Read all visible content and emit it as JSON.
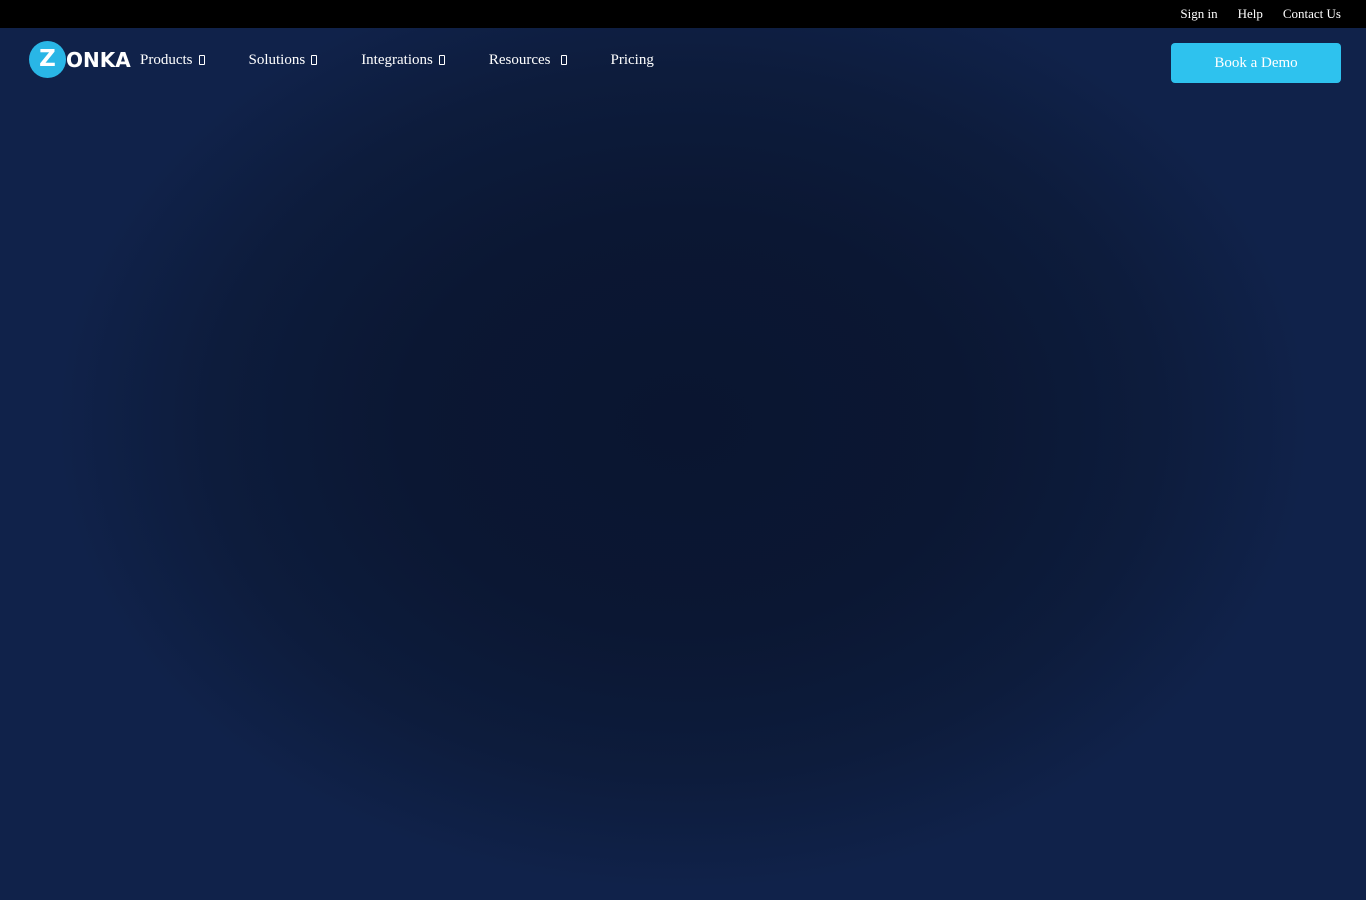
{
  "topbar": {
    "links": [
      {
        "label": "Sign in"
      },
      {
        "label": "Help"
      },
      {
        "label": "Contact Us"
      }
    ]
  },
  "logo": {
    "badge_letter": "Z",
    "wordmark": "ONKA"
  },
  "nav": {
    "items": [
      {
        "label": "Products",
        "has_dropdown": true
      },
      {
        "label": "Solutions",
        "has_dropdown": true
      },
      {
        "label": "Integrations",
        "has_dropdown": true
      },
      {
        "label": "Resources",
        "has_dropdown": true
      },
      {
        "label": "Pricing",
        "has_dropdown": false
      }
    ],
    "cta_label": "Book a Demo"
  },
  "colors": {
    "topbar_bg": "#000000",
    "page_bg": "#0b1733",
    "accent": "#2ec2ee",
    "logo_badge": "#29b6e6",
    "text": "#ffffff"
  },
  "icons": {
    "dropdown": "chevron-down-icon"
  }
}
